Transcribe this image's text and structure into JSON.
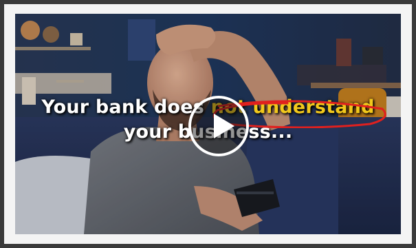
{
  "video": {
    "headline_part1": "Your bank does ",
    "headline_highlight": "not understand",
    "headline_line2": "your business...",
    "highlight_color": "#f2c81c",
    "circle_color": "#e0201e",
    "play_icon": "play-icon"
  }
}
